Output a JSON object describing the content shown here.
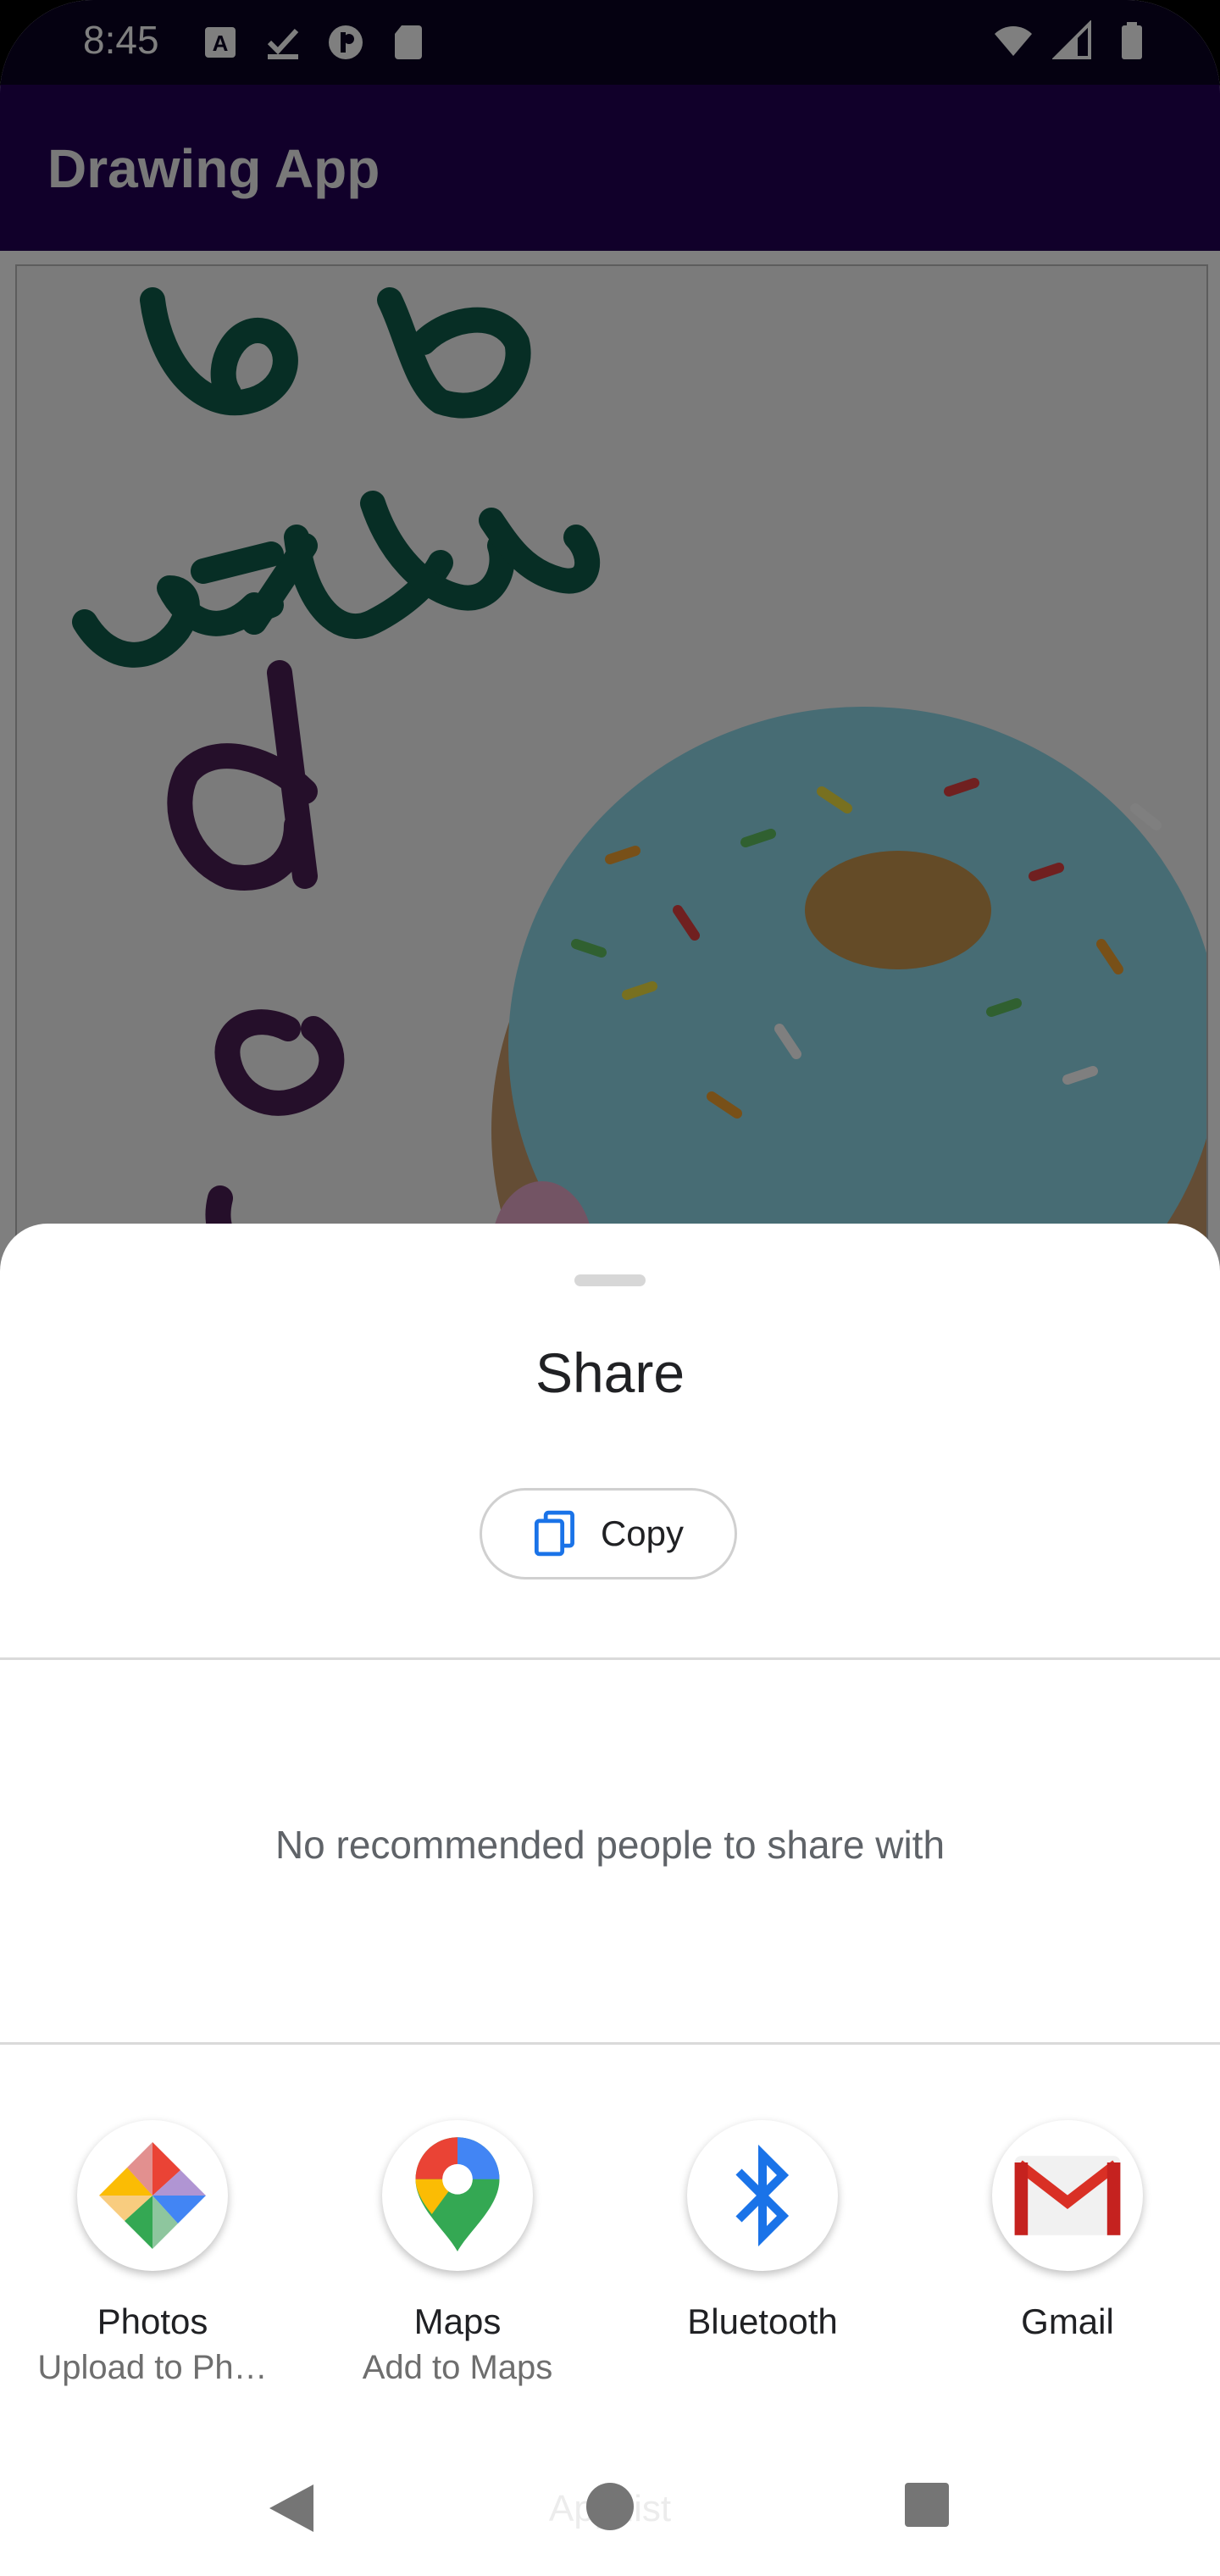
{
  "status_bar": {
    "time": "8:45",
    "left_icons": [
      "a-box-icon",
      "download-check-icon",
      "app-notification-icon",
      "sd-card-icon"
    ],
    "right_icons": [
      "wifi-icon",
      "cell-signal-icon",
      "battery-icon"
    ]
  },
  "app_bar": {
    "title": "Drawing App"
  },
  "canvas": {
    "stroke_colors": {
      "green": "#0f5c4a",
      "purple": "#4b1f54"
    }
  },
  "share_sheet": {
    "title": "Share",
    "copy_label": "Copy",
    "no_people_text": "No recommended people to share with",
    "targets": [
      {
        "name": "Photos",
        "subtitle": "Upload to Ph…",
        "icon": "photos-icon"
      },
      {
        "name": "Maps",
        "subtitle": "Add to Maps",
        "icon": "maps-icon"
      },
      {
        "name": "Bluetooth",
        "subtitle": "",
        "icon": "bluetooth-icon"
      },
      {
        "name": "Gmail",
        "subtitle": "",
        "icon": "gmail-icon"
      }
    ],
    "colors": {
      "accent": "#1a73e8"
    }
  },
  "nav_bar": {
    "hint": "App list"
  }
}
